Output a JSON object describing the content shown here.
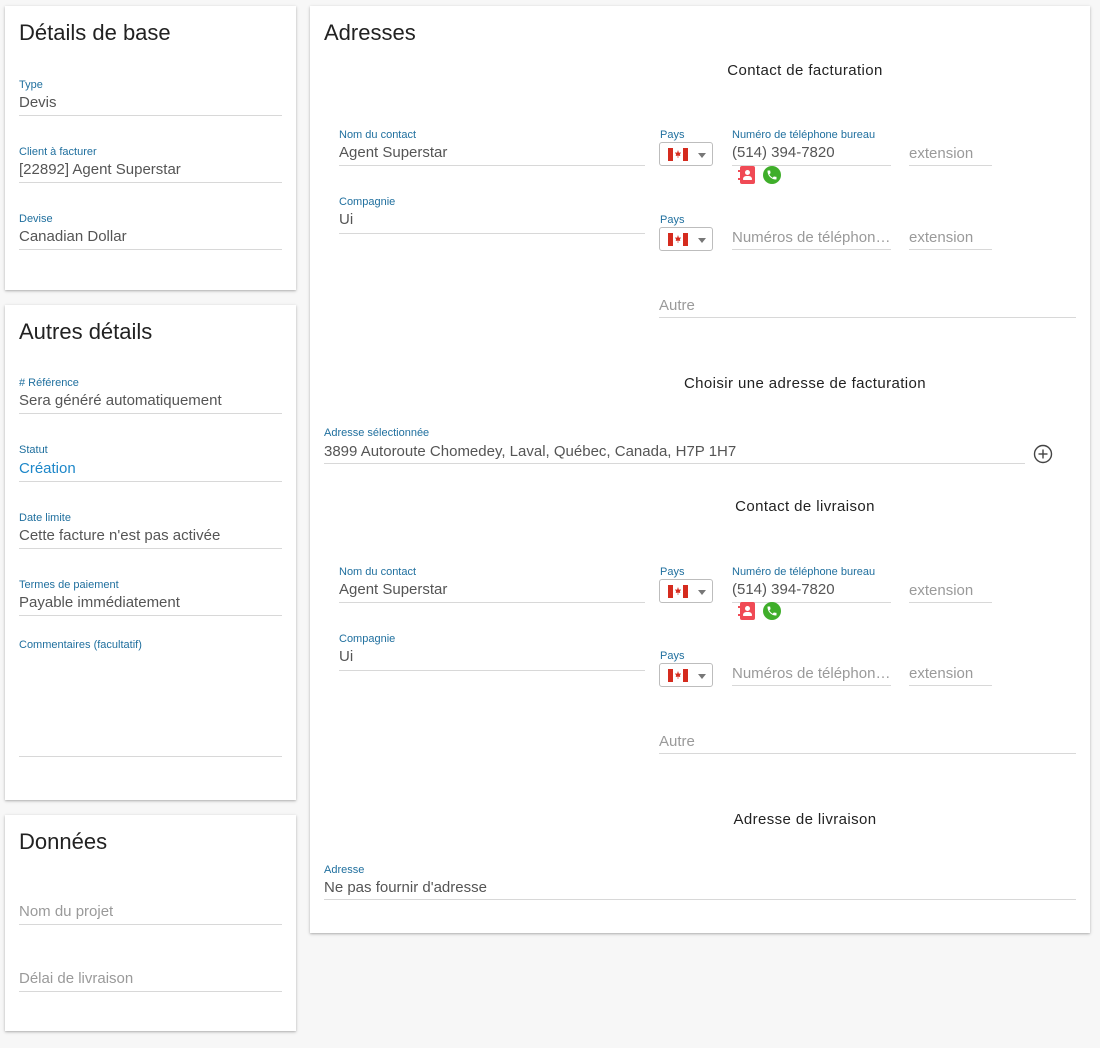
{
  "basic": {
    "title": "Détails de base",
    "type": {
      "label": "Type",
      "value": "Devis"
    },
    "client": {
      "label": "Client à facturer",
      "value": "[22892] Agent Superstar"
    },
    "currency": {
      "label": "Devise",
      "value": "Canadian Dollar"
    }
  },
  "other": {
    "title": "Autres détails",
    "reference": {
      "label": "# Référence",
      "value": "Sera généré automatiquement"
    },
    "status": {
      "label": "Statut",
      "value": "Création"
    },
    "due_date": {
      "label": "Date limite",
      "value": "Cette facture n'est pas activée"
    },
    "payment_terms": {
      "label": "Termes de paiement",
      "value": "Payable immédiatement"
    },
    "comments": {
      "label": "Commentaires (facultatif)",
      "value": ""
    }
  },
  "data_section": {
    "title": "Données",
    "project_name_placeholder": "Nom du projet",
    "delivery_delay_placeholder": "Délai de livraison"
  },
  "addresses": {
    "title": "Adresses",
    "billing_contact": {
      "heading": "Contact de facturation",
      "contact_name": {
        "label": "Nom du contact",
        "value": "Agent Superstar"
      },
      "company": {
        "label": "Compagnie",
        "value": "Ui"
      },
      "phone_country_label": "Pays",
      "office_phone": {
        "label": "Numéro de téléphone bureau",
        "value": "(514) 394-7820"
      },
      "extension_placeholder": "extension",
      "phone2_country_label": "Pays",
      "phone2_placeholder": "Numéros de téléphone…",
      "extension2_placeholder": "extension",
      "other_placeholder": "Autre"
    },
    "billing_address": {
      "heading": "Choisir une adresse de facturation",
      "selected_label": "Adresse sélectionnée",
      "selected_value": "3899 Autoroute Chomedey, Laval, Québec, Canada, H7P 1H7"
    },
    "delivery_contact": {
      "heading": "Contact de livraison",
      "contact_name": {
        "label": "Nom du contact",
        "value": "Agent Superstar"
      },
      "company": {
        "label": "Compagnie",
        "value": "Ui"
      },
      "phone_country_label": "Pays",
      "office_phone": {
        "label": "Numéro de téléphone bureau",
        "value": "(514) 394-7820"
      },
      "extension_placeholder": "extension",
      "phone2_country_label": "Pays",
      "phone2_placeholder": "Numéros de téléphone…",
      "extension2_placeholder": "extension",
      "other_placeholder": "Autre"
    },
    "delivery_address": {
      "heading": "Adresse de livraison",
      "address_label": "Adresse",
      "address_value": "Ne pas fournir d'adresse"
    }
  },
  "icons": {
    "flag": "canada-flag-icon",
    "contact": "contact-book-icon",
    "phone": "phone-call-icon",
    "add": "add-circle-icon"
  },
  "colors": {
    "label": "#1f6f9e",
    "status_value": "#1d87c9",
    "contact_icon": "#f04a55",
    "phone_icon": "#3fae2a"
  }
}
